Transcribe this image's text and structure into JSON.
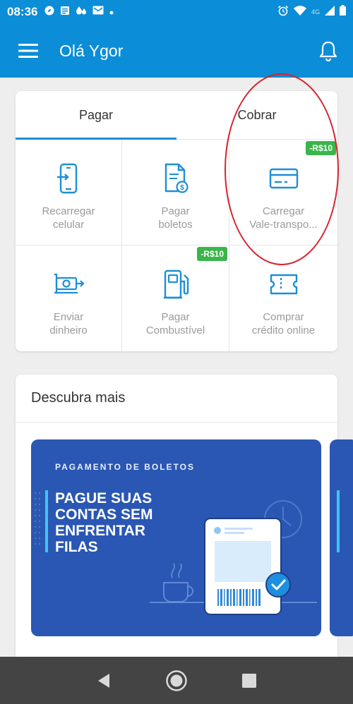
{
  "status_bar": {
    "time": "08:36",
    "network": "4G",
    "icons_left": [
      "compass-icon",
      "news-icon",
      "drops-icon",
      "mail-icon",
      "dot-icon"
    ],
    "icons_right": [
      "alarm-icon",
      "wifi-icon",
      "signal-icon",
      "battery-icon"
    ]
  },
  "app_bar": {
    "title": "Olá Ygor",
    "menu_icon": "hamburger-menu-icon",
    "notifications_icon": "bell-icon"
  },
  "tabs": [
    {
      "label": "Pagar",
      "active": true
    },
    {
      "label": "Cobrar",
      "active": false
    }
  ],
  "actions": [
    {
      "line1": "Recarregar",
      "line2": "celular",
      "icon": "phone-topup-icon",
      "badge": ""
    },
    {
      "line1": "Pagar",
      "line2": "boletos",
      "icon": "invoice-icon",
      "badge": ""
    },
    {
      "line1": "Carregar",
      "line2": "Vale-transpo...",
      "icon": "card-icon",
      "badge": "-R$10"
    },
    {
      "line1": "Enviar",
      "line2": "dinheiro",
      "icon": "send-money-icon",
      "badge": ""
    },
    {
      "line1": "Pagar",
      "line2": "Combustível",
      "icon": "fuel-pump-icon",
      "badge": "-R$10"
    },
    {
      "line1": "Comprar",
      "line2": "crédito online",
      "icon": "ticket-icon",
      "badge": ""
    }
  ],
  "discover": {
    "title": "Descubra mais",
    "banner": {
      "kicker": "PAGAMENTO DE BOLETOS",
      "headline": [
        "PAGUE SUAS",
        "CONTAS SEM",
        "ENFRENTAR",
        "FILAS"
      ]
    }
  },
  "colors": {
    "primary": "#0b8dd7",
    "icon_blue": "#1d8fd6",
    "badge_green": "#3ab54a",
    "banner_blue": "#2a57b3",
    "annotation_red": "#d6242e"
  }
}
